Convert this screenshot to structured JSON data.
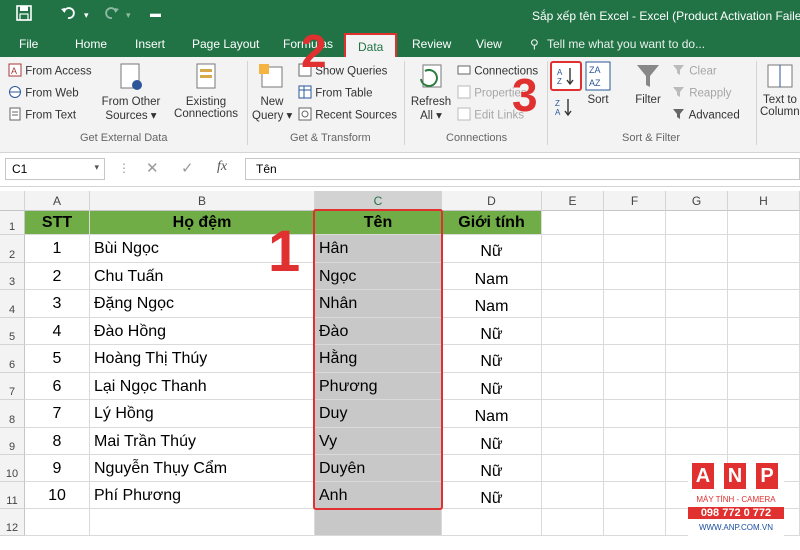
{
  "window_title": "Sắp xếp tên Excel - Excel (Product Activation Failed)",
  "tabs": [
    "File",
    "Home",
    "Insert",
    "Page Layout",
    "Formulas",
    "Data",
    "Review",
    "View"
  ],
  "tell_me": "Tell me what you want to do...",
  "ribbon": {
    "get_external": {
      "from_access": "From Access",
      "from_web": "From Web",
      "from_text": "From Text",
      "from_other_1": "From Other",
      "from_other_2": "Sources",
      "existing_1": "Existing",
      "existing_2": "Connections",
      "label": "Get External Data"
    },
    "transform": {
      "new_query_1": "New",
      "new_query_2": "Query",
      "show_queries": "Show Queries",
      "from_table": "From Table",
      "recent_sources": "Recent Sources",
      "label": "Get & Transform"
    },
    "connections": {
      "refresh_1": "Refresh",
      "refresh_2": "All",
      "connections": "Connections",
      "properties": "Properties",
      "edit_links": "Edit Links",
      "label": "Connections"
    },
    "sort_filter": {
      "sort": "Sort",
      "filter": "Filter",
      "clear": "Clear",
      "reapply": "Reapply",
      "advanced": "Advanced",
      "label": "Sort & Filter"
    },
    "data_tools": {
      "text_to_1": "Text to",
      "text_to_2": "Columns"
    }
  },
  "namebox": "C1",
  "formula": "Tên",
  "columns": [
    "A",
    "B",
    "C",
    "D",
    "E",
    "F",
    "G",
    "H"
  ],
  "rows": [
    "1",
    "2",
    "3",
    "4",
    "5",
    "6",
    "7",
    "8",
    "9",
    "10",
    "11",
    "12"
  ],
  "table": {
    "headers": [
      "STT",
      "Họ đệm",
      "Tên",
      "Giới tính"
    ],
    "rows": [
      [
        "1",
        "Bùi Ngọc",
        "Hân",
        "Nữ"
      ],
      [
        "2",
        "Chu Tuấn",
        "Ngọc",
        "Nam"
      ],
      [
        "3",
        "Đặng Ngọc",
        "Nhân",
        "Nam"
      ],
      [
        "4",
        "Đào Hồng",
        "Đào",
        "Nữ"
      ],
      [
        "5",
        "Hoàng Thị Thúy",
        "Hằng",
        "Nữ"
      ],
      [
        "6",
        "Lại Ngọc Thanh",
        "Phương",
        "Nữ"
      ],
      [
        "7",
        "Lý Hồng",
        "Duy",
        "Nam"
      ],
      [
        "8",
        "Mai Trần Thúy",
        "Vy",
        "Nữ"
      ],
      [
        "9",
        "Nguyễn Thụy Cẩm",
        "Duyên",
        "Nữ"
      ],
      [
        "10",
        "Phí Phương",
        "Anh",
        "Nữ"
      ]
    ]
  },
  "annotations": [
    "1",
    "2",
    "3"
  ],
  "logo": {
    "letters": [
      "A",
      "N",
      "P"
    ],
    "line1": "MÁY TÍNH - CAMERA",
    "line2": "098 772 0 772",
    "line3": "WWW.ANP.COM.VN"
  },
  "colors": {
    "excel_green": "#217346",
    "header_fill": "#70ad47",
    "annotation_red": "#e03030"
  }
}
